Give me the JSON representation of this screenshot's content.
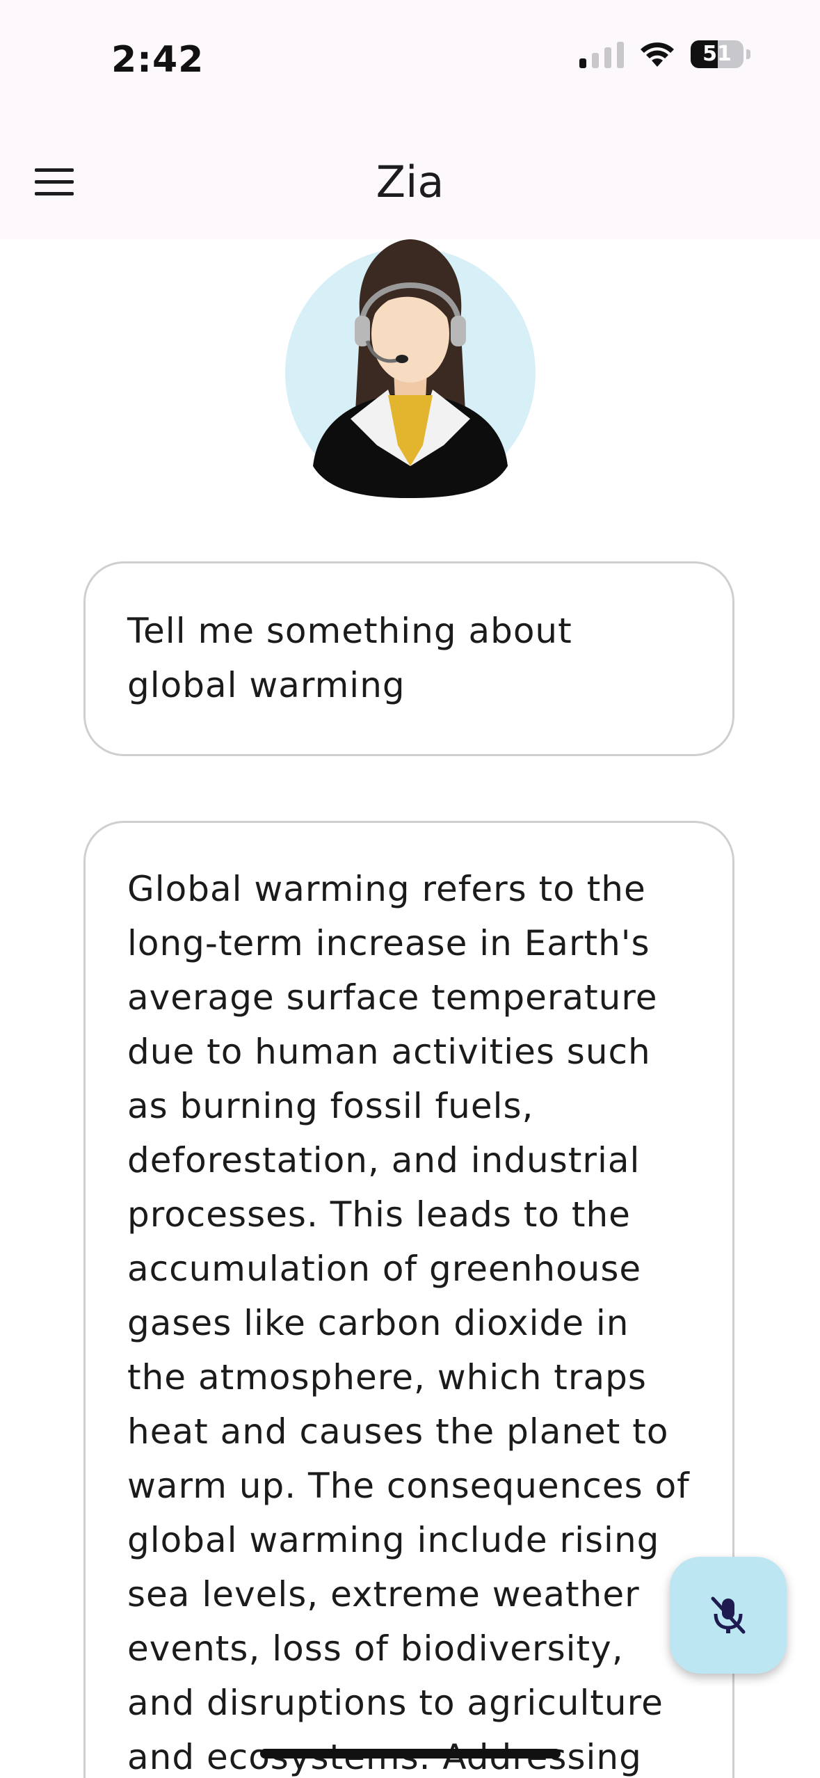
{
  "status_bar": {
    "time": "2:42",
    "battery": "51",
    "signal_bars_active": 1
  },
  "app_bar": {
    "title": "Zia",
    "menu_icon": "hamburger-menu-icon"
  },
  "avatar": {
    "icon": "support-agent-avatar",
    "bg_color": "#d7eff7"
  },
  "chat": {
    "messages": [
      {
        "role": "user",
        "text": "Tell me something about global warming"
      },
      {
        "role": "assistant",
        "text": "Global warming refers to the long-term increase in Earth's average surface temperature due to human activities such as burning fossil fuels, deforestation, and industrial processes. This leads to the accumulation of greenhouse gases like carbon dioxide in the atmosphere, which traps heat and causes the planet to warm up. The consequences of global warming include rising sea levels, extreme weather events, loss of biodiversity, and disruptions to agriculture and ecosystems. Addressing"
      }
    ]
  },
  "mic_button": {
    "icon": "mic-off-icon",
    "bg_color": "#bce6f1"
  }
}
